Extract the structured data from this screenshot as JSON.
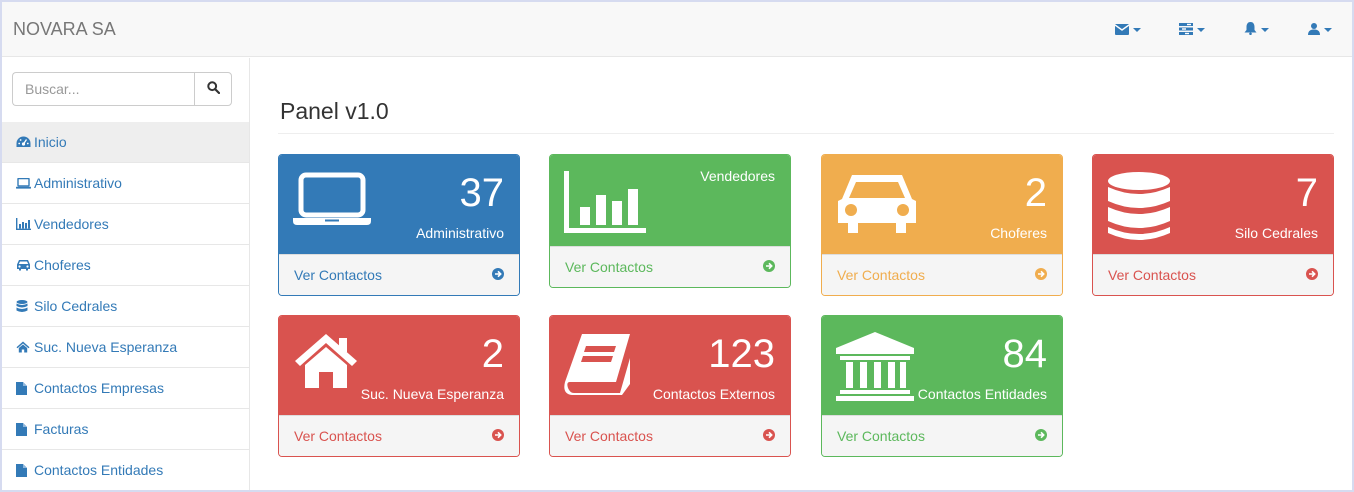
{
  "app": {
    "brand": "NOVARA SA"
  },
  "navbar": {
    "icons": [
      "envelope-icon",
      "tasks-icon",
      "bell-icon",
      "user-icon"
    ]
  },
  "search": {
    "placeholder": "Buscar...",
    "value": ""
  },
  "sidebar": {
    "items": [
      {
        "label": "Inicio",
        "icon": "dashboard-icon",
        "active": true
      },
      {
        "label": "Administrativo",
        "icon": "laptop-icon"
      },
      {
        "label": "Vendedores",
        "icon": "bar-chart-icon"
      },
      {
        "label": "Choferes",
        "icon": "car-icon"
      },
      {
        "label": "Silo Cedrales",
        "icon": "database-icon"
      },
      {
        "label": "Suc. Nueva Esperanza",
        "icon": "home-icon"
      },
      {
        "label": "Contactos Empresas",
        "icon": "file-icon"
      },
      {
        "label": "Facturas",
        "icon": "file-icon"
      },
      {
        "label": "Contactos Entidades",
        "icon": "file-icon"
      }
    ]
  },
  "main": {
    "title": "Panel v1.0",
    "panels": [
      {
        "count": "37",
        "label": "Administrativo",
        "link": "Ver Contactos",
        "color": "#337ab7",
        "icon": "laptop-icon"
      },
      {
        "count": "",
        "label": "Vendedores",
        "link": "Ver Contactos",
        "color": "#5cb85c",
        "icon": "bar-chart-icon"
      },
      {
        "count": "2",
        "label": "Choferes",
        "link": "Ver Contactos",
        "color": "#f0ad4e",
        "icon": "car-icon"
      },
      {
        "count": "7",
        "label": "Silo Cedrales",
        "link": "Ver Contactos",
        "color": "#d9534f",
        "icon": "database-icon"
      },
      {
        "count": "2",
        "label": "Suc. Nueva Esperanza",
        "link": "Ver Contactos",
        "color": "#d9534f",
        "icon": "home-icon"
      },
      {
        "count": "123",
        "label": "Contactos Externos",
        "link": "Ver Contactos",
        "color": "#d9534f",
        "icon": "book-icon"
      },
      {
        "count": "84",
        "label": "Contactos Entidades",
        "link": "Ver Contactos",
        "color": "#5cb85c",
        "icon": "bank-icon"
      }
    ]
  }
}
